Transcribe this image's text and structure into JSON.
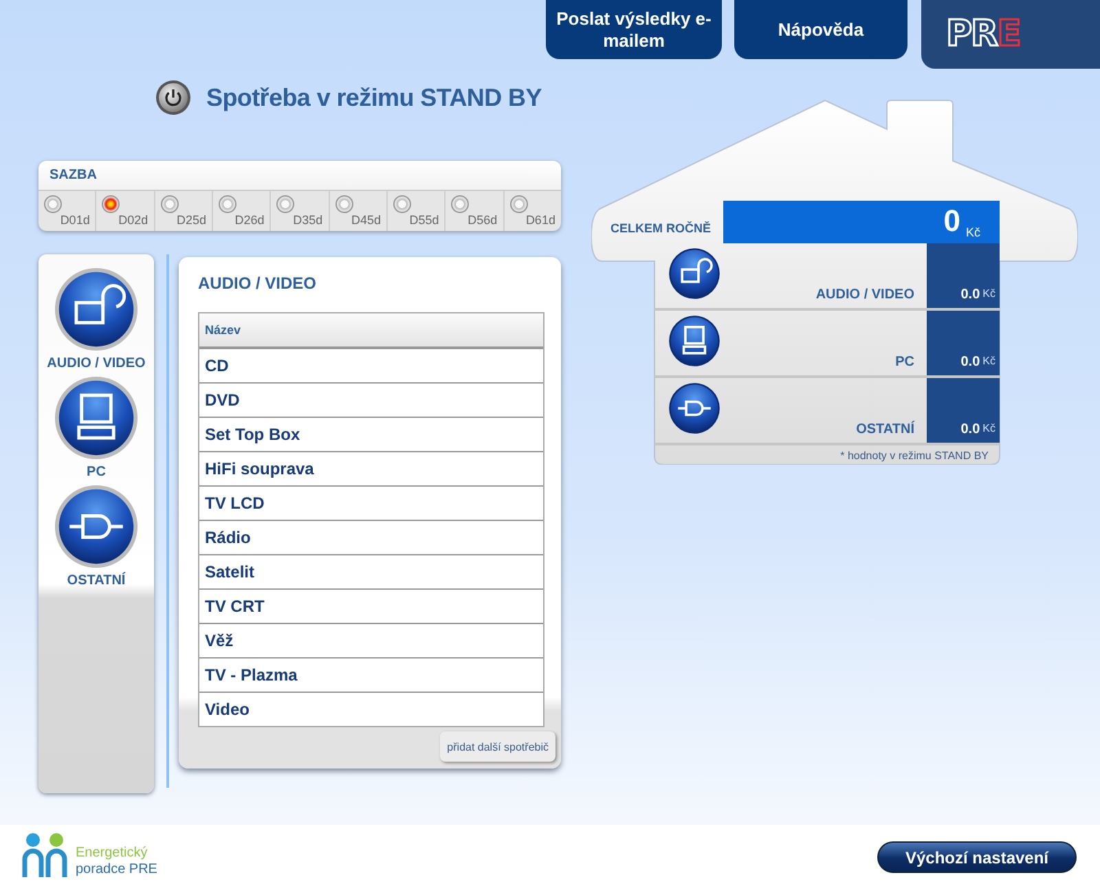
{
  "top_buttons": [
    {
      "label": "Poslat výsledky e-mailem"
    },
    {
      "label": "Nápověda"
    }
  ],
  "logo": {
    "main": "PR",
    "accent": "E"
  },
  "title": "Spotřeba v režimu STAND BY",
  "tariff": {
    "label": "SAZBA",
    "options": [
      {
        "label": "D01d",
        "selected": false
      },
      {
        "label": "D02d",
        "selected": true
      },
      {
        "label": "D25d",
        "selected": false
      },
      {
        "label": "D26d",
        "selected": false
      },
      {
        "label": "D35d",
        "selected": false
      },
      {
        "label": "D45d",
        "selected": false
      },
      {
        "label": "D55d",
        "selected": false
      },
      {
        "label": "D56d",
        "selected": false
      },
      {
        "label": "D61d",
        "selected": false
      }
    ]
  },
  "categories": [
    {
      "label": "AUDIO / VIDEO",
      "kind": "av"
    },
    {
      "label": "PC",
      "kind": "pc"
    },
    {
      "label": "OSTATNÍ",
      "kind": "other"
    }
  ],
  "device_panel": {
    "title": "AUDIO / VIDEO",
    "column": "Název",
    "rows": [
      "CD",
      "DVD",
      "Set Top Box",
      "HiFi souprava",
      "TV LCD",
      "Rádio",
      "Satelit",
      "TV CRT",
      "Věž",
      "TV - Plazma",
      "Video"
    ],
    "add_button": "přidat další spotřebič"
  },
  "summary": {
    "total_label": "CELKEM ROČNĚ",
    "total_value": "0",
    "total_unit": "Kč",
    "rows": [
      {
        "kind": "av",
        "label": "AUDIO / VIDEO",
        "value": "0.0",
        "unit": "Kč"
      },
      {
        "kind": "pc",
        "label": "PC",
        "value": "0.0",
        "unit": "Kč"
      },
      {
        "kind": "other",
        "label": "OSTATNÍ",
        "value": "0.0",
        "unit": "Kč"
      }
    ],
    "note": "* hodnoty v režimu STAND BY"
  },
  "footer": {
    "logo_line1": "Energetický",
    "logo_line2": "poradce PRE",
    "reset_button": "Výchozí nastavení"
  }
}
